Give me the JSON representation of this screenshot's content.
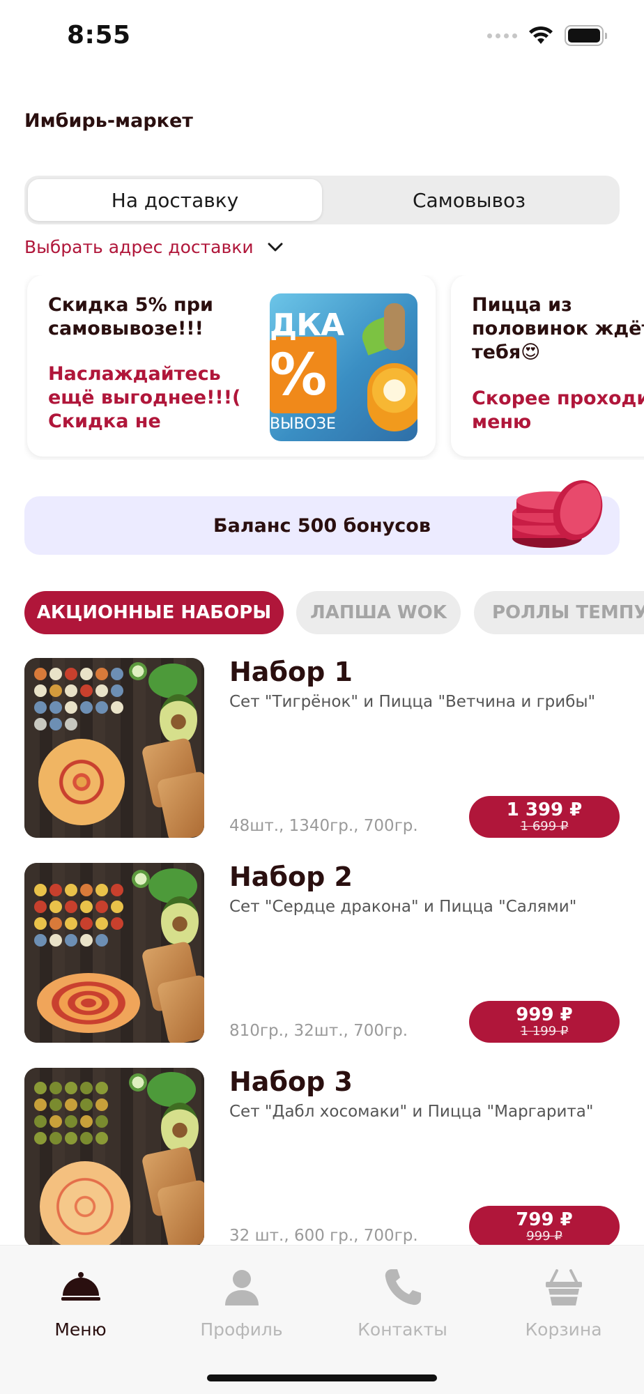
{
  "status_bar": {
    "time": "8:55"
  },
  "header": {
    "shop_name": "Имбирь-маркет"
  },
  "delivery_toggle": {
    "options": [
      "На доставку",
      "Самовывоз"
    ],
    "selected": "На доставку"
  },
  "address": {
    "label": "Выбрать адрес доставки",
    "icon": "chevron-down-icon"
  },
  "promos": [
    {
      "title": "Скидка 5% при самовывозе!!!",
      "description": "Наслаждайтесь ещё выгоднее!!!( Скидка не действует на ак...",
      "image_text_top": "ДКА",
      "image_text_pct": "%",
      "image_text_bottom": "ВЫВОЗЕ"
    },
    {
      "title": "Пицца из половинок ждёт тебя😍",
      "description": "Скорее проходи в меню"
    }
  ],
  "bonus": {
    "label": "Баланс 500 бонусов"
  },
  "categories": [
    "АКЦИОННЫЕ НАБОРЫ",
    "ЛАПША WOK",
    "РОЛЛЫ ТЕМПУРА"
  ],
  "products": [
    {
      "name": "Набор 1",
      "description": "Сет \"Тигрёнок\" и Пицца \"Ветчина и грибы\"",
      "weight": "48шт., 1340гр., 700гр.",
      "price": "1 399 ₽",
      "old_price": "1 699 ₽"
    },
    {
      "name": "Набор 2",
      "description": "Сет \"Сердце дракона\" и Пицца \"Салями\"",
      "weight": "810гр., 32шт., 700гр.",
      "price": "999 ₽",
      "old_price": "1 199 ₽"
    },
    {
      "name": "Набор 3",
      "description": "Сет \"Дабл хосомаки\" и Пицца \"Маргарита\"",
      "weight": "32 шт., 600 гр., 700гр.",
      "price": "799 ₽",
      "old_price": "999 ₽"
    }
  ],
  "tabbar": [
    {
      "label": "Меню",
      "icon": "cloche-icon",
      "active": true
    },
    {
      "label": "Профиль",
      "icon": "profile-icon",
      "active": false
    },
    {
      "label": "Контакты",
      "icon": "phone-icon",
      "active": false
    },
    {
      "label": "Корзина",
      "icon": "basket-icon",
      "active": false
    }
  ],
  "colors": {
    "accent": "#b0163a",
    "bonus_bg": "#ecebff",
    "text_dark": "#2a0f0f",
    "inactive": "#b7b7b7"
  }
}
